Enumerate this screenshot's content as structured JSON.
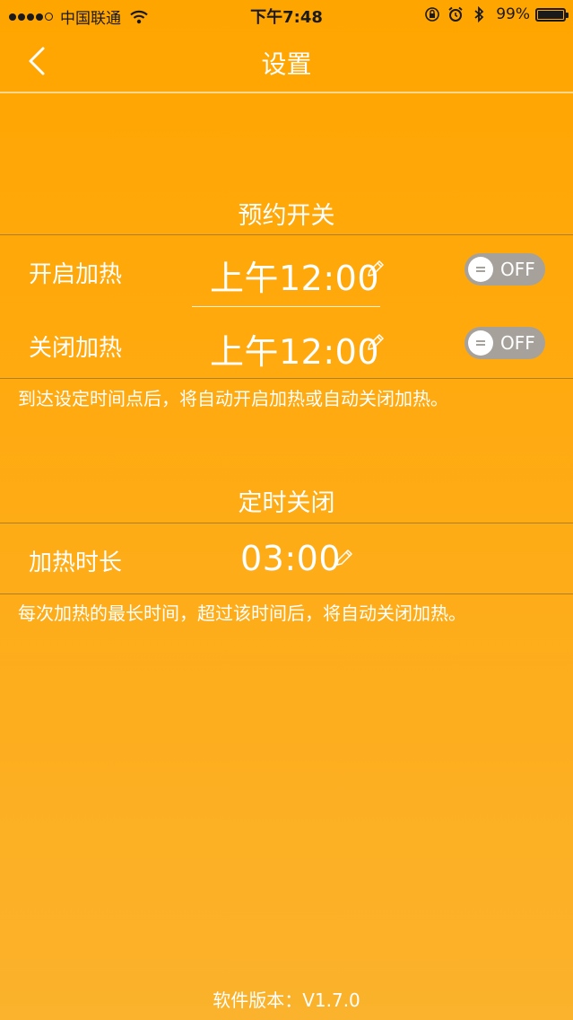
{
  "status_bar": {
    "carrier": "中国联通",
    "time": "下午7:48",
    "battery": "99%"
  },
  "nav": {
    "title": "设置"
  },
  "schedule_section": {
    "title": "预约开关",
    "rows": [
      {
        "label": "开启加热",
        "time": "上午12:00",
        "toggle": "OFF"
      },
      {
        "label": "关闭加热",
        "time": "上午12:00",
        "toggle": "OFF"
      }
    ],
    "hint": "到达设定时间点后，将自动开启加热或自动关闭加热。"
  },
  "timer_section": {
    "title": "定时关闭",
    "row": {
      "label": "加热时长",
      "time": "03:00"
    },
    "hint": "每次加热的最长时间，超过该时间后，将自动关闭加热。"
  },
  "footer": {
    "version": "软件版本：V1.7.0"
  },
  "icons": [
    "wifi-icon",
    "lock-rotation-icon",
    "alarm-icon",
    "bluetooth-icon",
    "battery-icon",
    "back-chevron-icon",
    "pencil-icon"
  ],
  "colors": {
    "background_top": "#ffa500",
    "background_bottom": "#fbb22c",
    "toggle_off": "#a6a29b",
    "text": "#ffffff"
  }
}
